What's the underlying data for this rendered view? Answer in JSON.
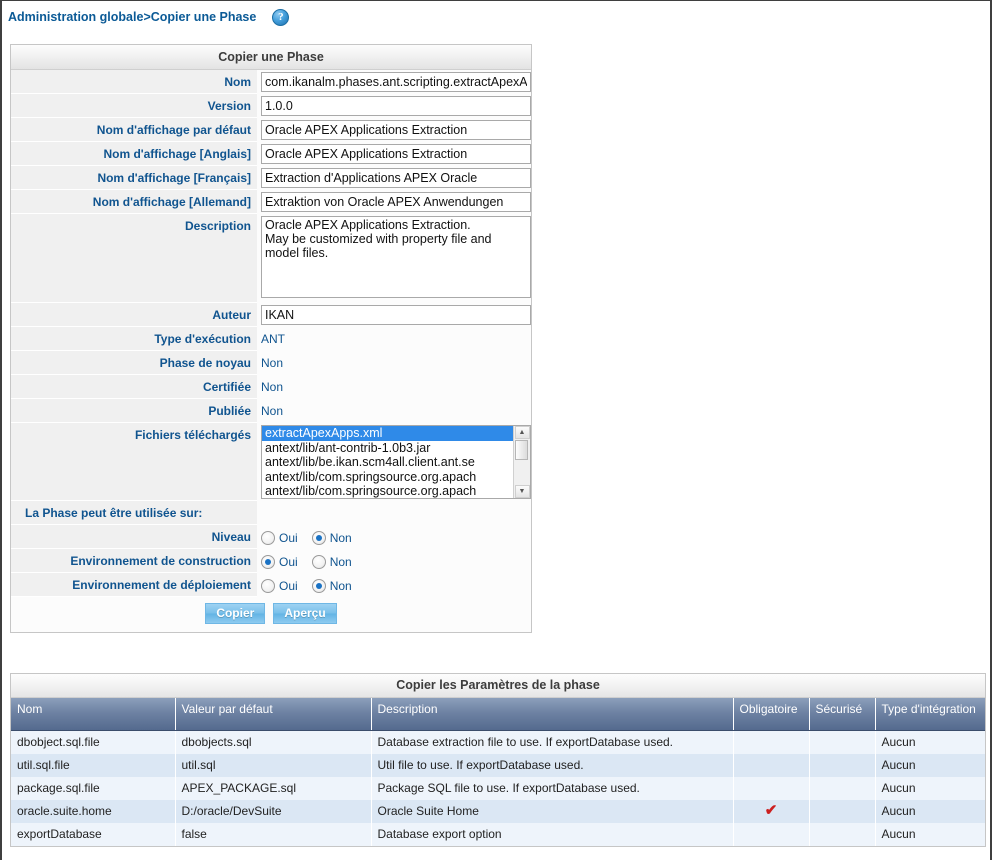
{
  "breadcrumb": {
    "root": "Administration globale",
    "separator": ">",
    "current": "Copier une Phase",
    "help_icon": "help-circle-icon",
    "help_glyph": "?"
  },
  "form": {
    "title": "Copier une Phase",
    "fields": {
      "nom_label": "Nom",
      "nom_value": "com.ikanalm.phases.ant.scripting.extractApexApps",
      "version_label": "Version",
      "version_value": "1.0.0",
      "display_default_label": "Nom d'affichage par défaut",
      "display_default_value": "Oracle APEX Applications Extraction",
      "display_en_label": "Nom d'affichage [Anglais]",
      "display_en_value": "Oracle APEX Applications Extraction",
      "display_fr_label": "Nom d'affichage [Français]",
      "display_fr_value": "Extraction d'Applications APEX Oracle",
      "display_de_label": "Nom d'affichage [Allemand]",
      "display_de_value": "Extraktion von Oracle APEX Anwendungen",
      "description_label": "Description",
      "description_value": "Oracle APEX Applications Extraction.\nMay be customized with property file and model files.",
      "auteur_label": "Auteur",
      "auteur_value": "IKAN",
      "exec_type_label": "Type d'exécution",
      "exec_type_value": "ANT",
      "core_phase_label": "Phase de noyau",
      "core_phase_value": "Non",
      "certified_label": "Certifiée",
      "certified_value": "Non",
      "published_label": "Publiée",
      "published_value": "Non",
      "files_label": "Fichiers téléchargés"
    },
    "uploaded_files": [
      "extractApexApps.xml",
      "antext/lib/ant-contrib-1.0b3.jar",
      "antext/lib/be.ikan.scm4all.client.ant.se",
      "antext/lib/com.springsource.org.apach",
      "antext/lib/com.springsource.org.apach"
    ],
    "usage_section_label": "La Phase peut être utilisée sur:",
    "usage_rows": [
      {
        "label": "Niveau",
        "yes": "Oui",
        "no": "Non",
        "selected": "no"
      },
      {
        "label": "Environnement de construction",
        "yes": "Oui",
        "no": "Non",
        "selected": "yes"
      },
      {
        "label": "Environnement de déploiement",
        "yes": "Oui",
        "no": "Non",
        "selected": "no"
      }
    ],
    "buttons": {
      "copy": "Copier",
      "preview": "Aperçu"
    }
  },
  "params_table": {
    "title": "Copier les Paramètres de la phase",
    "columns": [
      "Nom",
      "Valeur par défaut",
      "Description",
      "Obligatoire",
      "Sécurisé",
      "Type d'intégration"
    ],
    "rows": [
      {
        "nom": "dbobject.sql.file",
        "valeur": "dbobjects.sql",
        "description": "Database extraction file to use. If exportDatabase used.",
        "obligatoire": "",
        "securise": "",
        "type": "Aucun"
      },
      {
        "nom": "util.sql.file",
        "valeur": "util.sql",
        "description": "Util file to use. If exportDatabase used.",
        "obligatoire": "",
        "securise": "",
        "type": "Aucun"
      },
      {
        "nom": "package.sql.file",
        "valeur": "APEX_PACKAGE.sql",
        "description": "Package SQL file to use. If exportDatabase used.",
        "obligatoire": "",
        "securise": "",
        "type": "Aucun"
      },
      {
        "nom": "oracle.suite.home",
        "valeur": "D:/oracle/DevSuite",
        "description": "Oracle Suite Home",
        "obligatoire": "✔",
        "securise": "",
        "type": "Aucun"
      },
      {
        "nom": "exportDatabase",
        "valeur": "false",
        "description": "Database export option",
        "obligatoire": "",
        "securise": "",
        "type": "Aucun"
      }
    ]
  },
  "colors": {
    "label_blue": "#10548f",
    "link_blue": "#0b5a96",
    "table_header": "#6e82a3",
    "row_odd": "#eef4fb",
    "row_even": "#dbe7f4",
    "selection_blue": "#2f8ae8",
    "required_tick": "#cc1f1f",
    "button_blue": "#79c0ea"
  }
}
